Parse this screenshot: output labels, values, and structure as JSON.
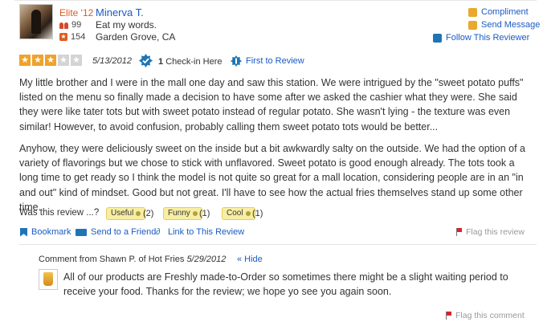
{
  "user": {
    "elite": "Elite '12",
    "name": "Minerva T.",
    "friends": "99",
    "reviews": "154",
    "tagline": "Eat my words.",
    "location": "Garden Grove, CA"
  },
  "actions": {
    "compliment": "Compliment",
    "send_message": "Send Message",
    "follow": "Follow This Reviewer"
  },
  "review": {
    "rating": 3,
    "max_rating": 5,
    "date": "5/13/2012",
    "checkin_count": "1",
    "checkin_label": "Check-in Here",
    "first_to_review": "First to Review",
    "paragraph1": "My little brother and I were in the mall one day and saw this station. We were intrigued by the \"sweet potato puffs\" listed on the menu so finally made a decision to have some after we asked the cashier what they were. She said they were like tater tots but with sweet potato instead of regular potato. She wasn't lying - the texture was even similar! However, to avoid confusion, probably calling them sweet potato tots would be better...",
    "paragraph2": "Anyhow, they were deliciously sweet on the inside but a bit awkwardly salty on the outside. We had the option of a variety of flavorings but we chose to stick with unflavored. Sweet potato is good enough already. The tots took a long time to get ready so I think the model is not quite so great for a mall location, considering people are in an \"in and out\" kind of mindset. Good but not great. I'll have to see how the actual fries themselves stand up some other time."
  },
  "votes": {
    "prompt": "Was this review ...?",
    "useful_label": "Useful",
    "useful_count": "(2)",
    "funny_label": "Funny",
    "funny_count": "(1)",
    "cool_label": "Cool",
    "cool_count": "(1)"
  },
  "tools": {
    "bookmark": "Bookmark",
    "send_friend": "Send to a Friend",
    "link": "Link to This Review",
    "flag_review": "Flag this review"
  },
  "owner_comment": {
    "heading": "Comment from Shawn P. of Hot Fries",
    "date": "5/29/2012",
    "hide": "« Hide",
    "text": "All of our products are Freshly made-to-Order so sometimes there might be a slight waiting period to receive your food. Thanks for the review; we hope yo see you again soon.",
    "flag": "Flag this comment"
  },
  "colors": {
    "link": "#1a5bc4",
    "elite": "#e05a1e",
    "star_on": "#f0a22b",
    "star_off": "#d4d4d4",
    "vote_bg": "#f7eea3"
  },
  "icons": [
    "friends-icon",
    "reviews-icon",
    "compliment-icon",
    "message-icon",
    "follow-icon",
    "checkin-badge-icon",
    "first-review-badge-icon",
    "bookmark-icon",
    "send-icon",
    "link-icon",
    "flag-icon"
  ]
}
